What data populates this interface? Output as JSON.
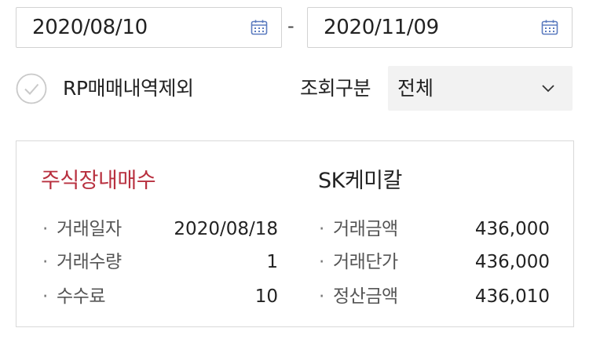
{
  "date_range": {
    "start": "2020/08/10",
    "separator": "-",
    "end": "2020/11/09",
    "icon": "calendar-icon"
  },
  "options": {
    "exclude_rp_label": "RP매매내역제외",
    "exclude_rp_checked": false,
    "query_type_label": "조회구분",
    "query_type_value": "전체"
  },
  "trade": {
    "type": "주식장내매수",
    "stock_name": "SK케미칼",
    "left_fields": [
      {
        "label": "거래일자",
        "value": "2020/08/18"
      },
      {
        "label": "거래수량",
        "value": "1"
      },
      {
        "label": "수수료",
        "value": "10"
      }
    ],
    "right_fields": [
      {
        "label": "거래금액",
        "value": "436,000"
      },
      {
        "label": "거래단가",
        "value": "436,000"
      },
      {
        "label": "정산금액",
        "value": "436,010"
      }
    ]
  },
  "colors": {
    "accent_red": "#b8303f",
    "calendar_blue": "#5b7bbf",
    "border": "#d2d2d2"
  }
}
